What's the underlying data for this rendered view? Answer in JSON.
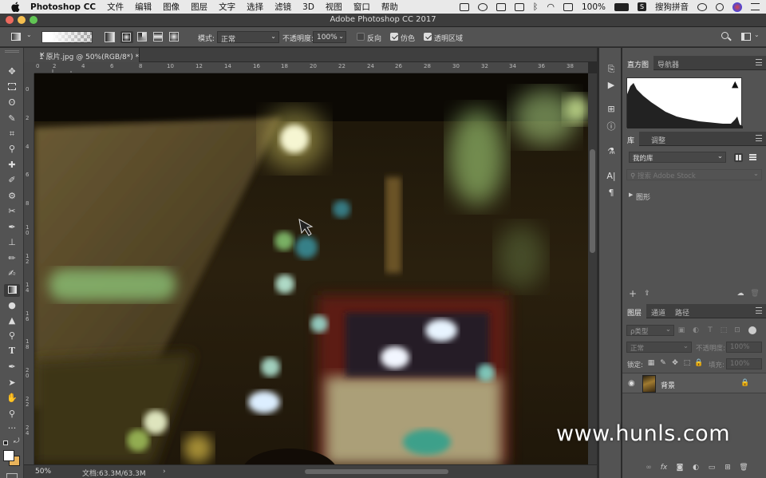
{
  "menubar": {
    "app_name": "Photoshop CC",
    "items": [
      "文件",
      "编辑",
      "图像",
      "图层",
      "文字",
      "选择",
      "滤镜",
      "3D",
      "视图",
      "窗口",
      "帮助"
    ],
    "battery": "100%",
    "input_method": "搜狗拼音"
  },
  "window": {
    "title": "Adobe Photoshop CC 2017"
  },
  "options": {
    "mode_label": "模式:",
    "mode_value": "正常",
    "opacity_label": "不透明度:",
    "opacity_value": "100%",
    "reverse_label": "反向",
    "dither_label": "仿色",
    "transparency_label": "透明区域",
    "reverse_checked": false,
    "dither_checked": true,
    "transparency_checked": true
  },
  "document": {
    "tab_title": "1 原片.jpg @ 50%(RGB/8*) *",
    "zoom": "50%",
    "doc_size": "文档:63.3M/63.3M"
  },
  "rulers": {
    "top": [
      "0",
      "2",
      "4",
      "6",
      "8",
      "10",
      "12",
      "14",
      "16",
      "18",
      "20",
      "22",
      "24",
      "26",
      "28",
      "30",
      "32",
      "34",
      "36",
      "38"
    ],
    "left": [
      "0",
      "2",
      "4",
      "6",
      "8",
      "1 0",
      "1 2",
      "1 4",
      "1 6",
      "1 8",
      "2 0",
      "2 2",
      "2 4"
    ]
  },
  "histogram_panel": {
    "tabs": [
      "直方图",
      "导航器"
    ]
  },
  "library_panel": {
    "tabs": [
      "库",
      "调整"
    ],
    "library_name": "我的库",
    "search_placeholder": "搜索 Adobe Stock",
    "section": "图形"
  },
  "layers_panel": {
    "tabs": [
      "图层",
      "通道",
      "路径"
    ],
    "filter_kind": "ρ类型",
    "blend_mode": "正常",
    "opacity_label": "不透明度:",
    "opacity_value": "100%",
    "lock_label": "锁定:",
    "fill_label": "填充:",
    "fill_value": "100%",
    "layer_name": "背景"
  },
  "watermark": "www.hunls.com",
  "colors": {
    "foreground": "#ffffff",
    "background": "#e9b35a",
    "accent_blue": "#2f7de0"
  }
}
